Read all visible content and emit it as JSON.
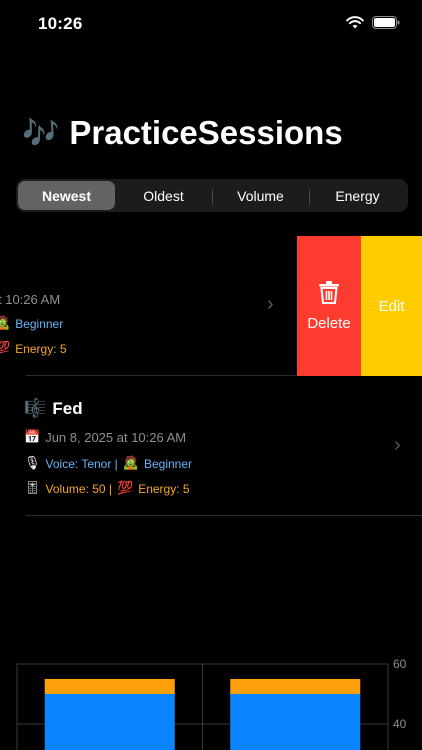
{
  "status_bar": {
    "time": "10:26"
  },
  "header": {
    "emoji": "🎶",
    "title": "PracticeSessions"
  },
  "sort_control": {
    "options": [
      "Newest",
      "Oldest",
      "Volume",
      "Energy"
    ],
    "selected": "Newest"
  },
  "sessions": [
    {
      "date_partial": "t 10:26 AM",
      "level": "Beginner",
      "energy_partial": "Energy: 5",
      "actions": {
        "delete": "Delete",
        "edit": "Edit"
      }
    },
    {
      "name_emoji": "🎼",
      "name": "Fed",
      "date_emoji": "📅",
      "date": "Jun 8, 2025 at 10:26 AM",
      "voice_emoji": "🎙",
      "voice": "Voice: Tenor |",
      "level_emoji": "🧟",
      "level": "Beginner",
      "volume_emoji": "🎚",
      "volume": "Volume: 50 |",
      "energy_emoji": "💯",
      "energy": "Energy: 5"
    }
  ],
  "chart_data": {
    "type": "bar",
    "stacked": true,
    "categories": [
      "",
      ""
    ],
    "series": [
      {
        "values": [
          50,
          50
        ],
        "color": "#0a84ff"
      },
      {
        "values": [
          5,
          5
        ],
        "color": "#ff9f0a"
      }
    ],
    "y_ticks": [
      "60",
      "40"
    ],
    "ylim": [
      30,
      63
    ],
    "grid": true
  }
}
